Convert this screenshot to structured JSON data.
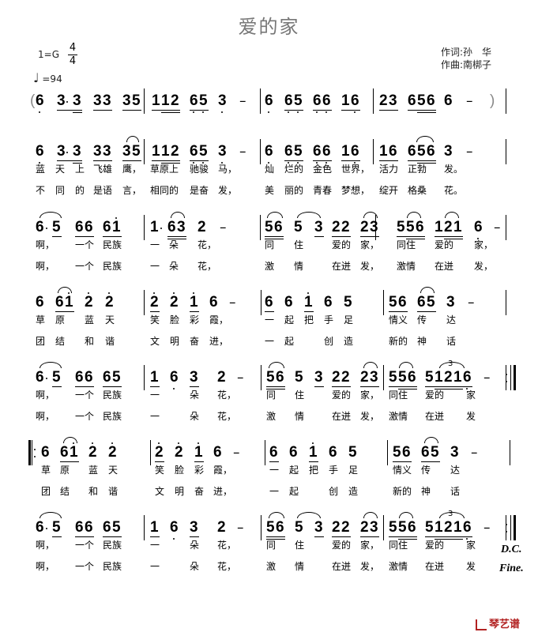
{
  "header": {
    "title": "爱的家",
    "key": "1=G",
    "time_sig_top": "4",
    "time_sig_bottom": "4",
    "tempo_icon": "quarter-note-icon",
    "tempo": "=94",
    "lyricist": "作词:孙　华",
    "composer": "作曲:南梆子"
  },
  "rows": [
    {
      "measures": [
        {
          "notes": "(6 3·3 33 35"
        },
        {
          "notes": "112 65 3 -"
        },
        {
          "notes": "6 65 66 16"
        },
        {
          "notes": "23 656 6 - )"
        }
      ],
      "lyrics1": [],
      "lyrics2": []
    },
    {
      "measures": [
        {
          "notes": "6 3·3 33 35"
        },
        {
          "notes": "112 65 3 -"
        },
        {
          "notes": "6 65 66 16"
        },
        {
          "notes": "16 656 3 -"
        }
      ],
      "lyrics1": [
        "蓝",
        "天",
        "上",
        "飞雄",
        "鹰，",
        "草原上",
        "驰骏",
        "马，",
        "灿",
        "烂的",
        "金色",
        "世界，",
        "活力",
        "正勃",
        "发。"
      ],
      "lyrics2": [
        "不",
        "同",
        "的",
        "是语",
        "言，",
        "相同的",
        "是奋",
        "发，",
        "美",
        "丽的",
        "青春",
        "梦想，",
        "绽开",
        "格桑",
        "花。"
      ]
    },
    {
      "measures": [
        {
          "notes": "6·5 66 61"
        },
        {
          "notes": "1·63 2 -"
        },
        {
          "notes": "56 5 3 22 23"
        },
        {
          "notes": "556 121 6 -"
        }
      ],
      "lyrics1": [
        "啊，",
        "一个",
        "民族",
        "一",
        "朵",
        "花，",
        "同",
        "住",
        "爱的",
        "家，",
        "同住",
        "爱的",
        "家，"
      ],
      "lyrics2": [
        "啊，",
        "一个",
        "民族",
        "一",
        "朵",
        "花，",
        "激",
        "情",
        "在迸",
        "发，",
        "激情",
        "在迸",
        "发，"
      ]
    },
    {
      "measures": [
        {
          "notes": "6 61 2 2"
        },
        {
          "notes": "2 2 1 6 -"
        },
        {
          "notes": "6 6 1 6 5"
        },
        {
          "notes": "56 65 3 -"
        }
      ],
      "lyrics1": [
        "草",
        "原",
        "蓝",
        "天",
        "笑",
        "脸",
        "彩",
        "霞，",
        "一",
        "起",
        "把",
        "手",
        "足",
        "情义",
        "传",
        "达"
      ],
      "lyrics2": [
        "团",
        "结",
        "和",
        "谐",
        "文",
        "明",
        "奋",
        "进，",
        "一",
        "起",
        "",
        "创",
        "造",
        "新的",
        "神",
        "话"
      ]
    },
    {
      "measures": [
        {
          "notes": "6·5 66 65"
        },
        {
          "notes": "1 6 3 2 -"
        },
        {
          "notes": "56 5 3 22 23"
        },
        {
          "notes": "556 51216 - :||"
        }
      ],
      "lyrics1": [
        "啊，",
        "一个",
        "民族",
        "一",
        "朵",
        "花，",
        "同",
        "住",
        "爱的",
        "家，",
        "同住",
        "爱的",
        "家"
      ],
      "lyrics2": [
        "啊，",
        "一个",
        "民族",
        "一",
        "朵",
        "花，",
        "激",
        "情",
        "在迸",
        "发，",
        "激情",
        "在迸",
        "发"
      ]
    },
    {
      "measures": [
        {
          "notes": "||: 6 61 2 2"
        },
        {
          "notes": "2 2 1 6 -"
        },
        {
          "notes": "6 6 1 6 5"
        },
        {
          "notes": "56 65 3 -"
        }
      ],
      "lyrics1": [
        "草",
        "原",
        "蓝",
        "天",
        "笑",
        "脸",
        "彩",
        "霞，",
        "一",
        "起",
        "把",
        "手",
        "足",
        "情义",
        "传",
        "达"
      ],
      "lyrics2": [
        "团",
        "结",
        "和",
        "谐",
        "文",
        "明",
        "奋",
        "进，",
        "一",
        "起",
        "",
        "创",
        "造",
        "新的",
        "神",
        "话"
      ]
    },
    {
      "measures": [
        {
          "notes": "6·5 66 65"
        },
        {
          "notes": "1 6 3 2 -"
        },
        {
          "notes": "56 5 3 22 23"
        },
        {
          "notes": "556 51216 - :||"
        }
      ],
      "lyrics1": [
        "啊，",
        "一个",
        "民族",
        "一",
        "朵",
        "花，",
        "同",
        "住",
        "爱的",
        "家，",
        "同住",
        "爱的",
        "家"
      ],
      "lyrics2": [
        "啊，",
        "一个",
        "民族",
        "一",
        "朵",
        "花，",
        "激",
        "情",
        "在迸",
        "发，",
        "激情",
        "在迸",
        "发"
      ]
    }
  ],
  "footer": {
    "dc": "D.C.",
    "fine": "Fine.",
    "logo_text": "琴艺谱",
    "logo_icon": "qinyipu-logo-icon"
  },
  "triplet_label": "3"
}
